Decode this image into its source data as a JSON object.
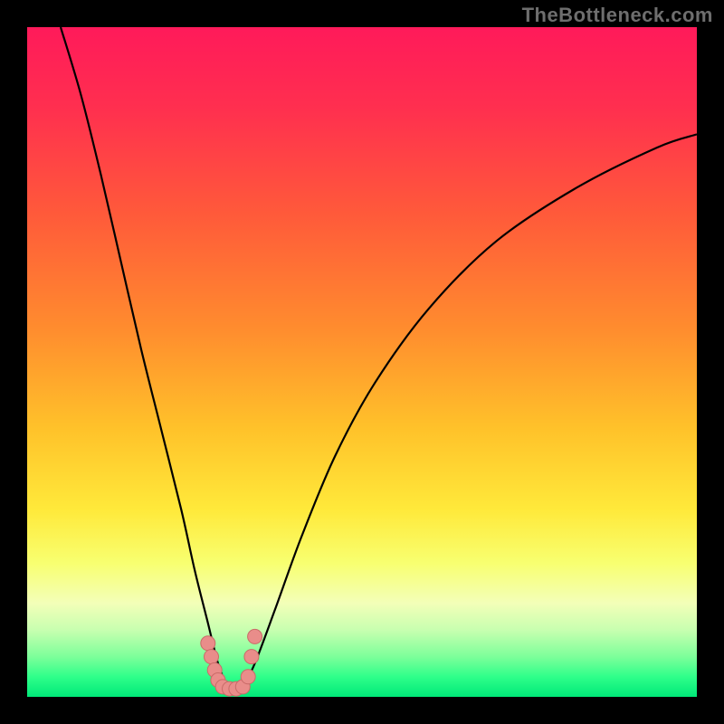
{
  "watermark": "TheBottleneck.com",
  "colors": {
    "bg": "#000000",
    "gradient_stops": [
      {
        "offset": 0.0,
        "color": "#ff1a5a"
      },
      {
        "offset": 0.12,
        "color": "#ff2f4f"
      },
      {
        "offset": 0.28,
        "color": "#ff5a3a"
      },
      {
        "offset": 0.45,
        "color": "#ff8c2e"
      },
      {
        "offset": 0.6,
        "color": "#ffc22a"
      },
      {
        "offset": 0.72,
        "color": "#ffe93a"
      },
      {
        "offset": 0.8,
        "color": "#f8ff70"
      },
      {
        "offset": 0.86,
        "color": "#f3ffb8"
      },
      {
        "offset": 0.9,
        "color": "#c8ffb0"
      },
      {
        "offset": 0.94,
        "color": "#7dff9a"
      },
      {
        "offset": 0.97,
        "color": "#2fff8a"
      },
      {
        "offset": 1.0,
        "color": "#00e878"
      }
    ],
    "curve_stroke": "#000000",
    "marker_fill": "#e98d8a",
    "marker_stroke": "#c96b68"
  },
  "chart_data": {
    "type": "line",
    "title": "",
    "xlabel": "",
    "ylabel": "",
    "xlim": [
      0,
      100
    ],
    "ylim": [
      0,
      100
    ],
    "grid": false,
    "legend": false,
    "description": "Chart with two curved branches forming valley near x≈30; y corresponds to bottleneck percentage (0 = green at bottom, 100 = red at top). Background heat gradient encodes same percentage scale.",
    "series": [
      {
        "name": "left-branch",
        "x": [
          5,
          8,
          11,
          14,
          17,
          20,
          23,
          25,
          27,
          28.5,
          30
        ],
        "y": [
          100,
          90,
          78,
          65,
          52,
          40,
          28,
          19,
          11,
          5,
          1
        ]
      },
      {
        "name": "right-branch",
        "x": [
          32,
          34,
          37,
          41,
          46,
          52,
          60,
          70,
          82,
          94,
          100
        ],
        "y": [
          1,
          5,
          13,
          24,
          36,
          47,
          58,
          68,
          76,
          82,
          84
        ]
      }
    ],
    "markers": {
      "name": "highlighted-points",
      "points": [
        {
          "x": 27.0,
          "y": 8
        },
        {
          "x": 27.5,
          "y": 6
        },
        {
          "x": 28.0,
          "y": 4
        },
        {
          "x": 28.5,
          "y": 2.5
        },
        {
          "x": 29.2,
          "y": 1.5
        },
        {
          "x": 30.2,
          "y": 1.2
        },
        {
          "x": 31.2,
          "y": 1.2
        },
        {
          "x": 32.2,
          "y": 1.5
        },
        {
          "x": 33.0,
          "y": 3
        },
        {
          "x": 33.5,
          "y": 6
        },
        {
          "x": 34.0,
          "y": 9
        }
      ],
      "radius_px": 8
    }
  }
}
